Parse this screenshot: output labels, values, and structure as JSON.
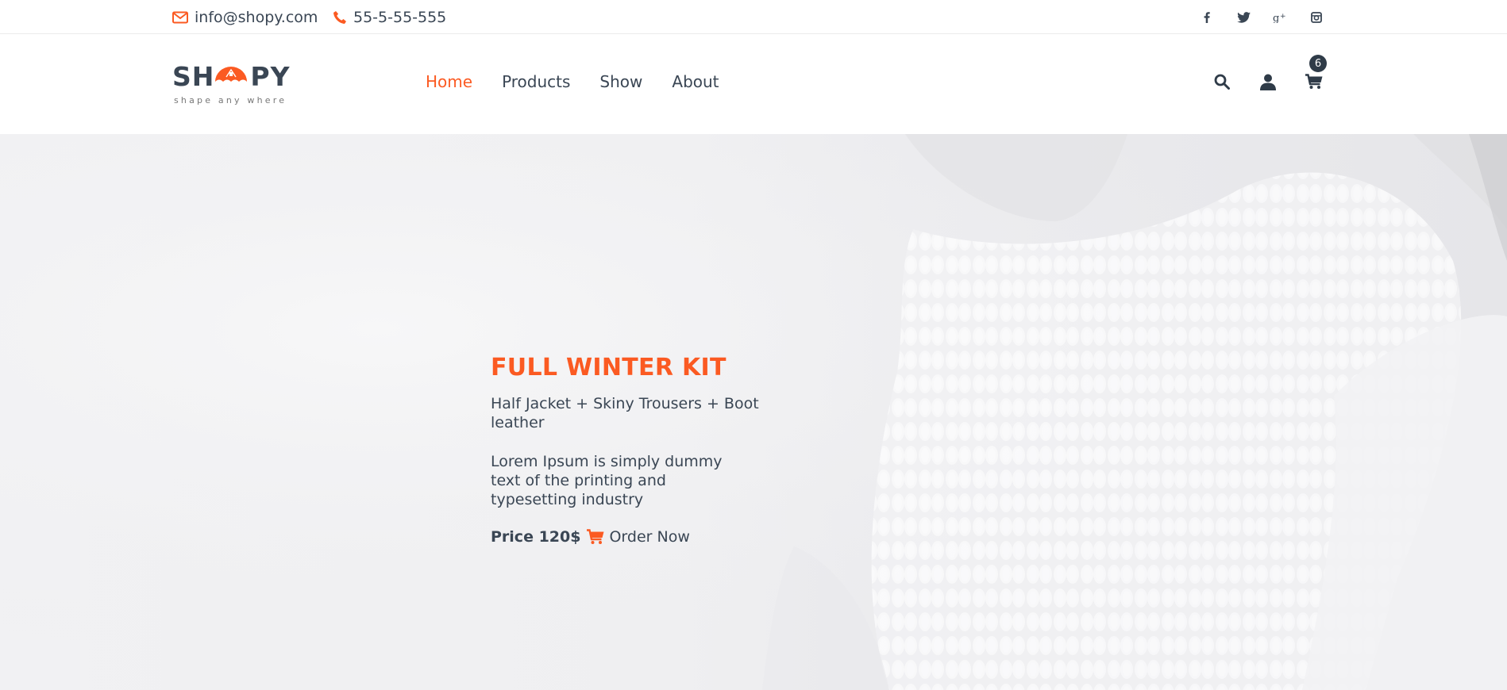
{
  "topbar": {
    "email": "info@shopy.com",
    "phone": "55-5-55-555",
    "socials": [
      "facebook-icon",
      "twitter-icon",
      "google-plus-icon",
      "instagram-icon"
    ]
  },
  "logo": {
    "left_text": "SH",
    "right_text": "PY",
    "tagline": "shape any where"
  },
  "nav": {
    "items": [
      {
        "label": "Home",
        "active": true
      },
      {
        "label": "Products",
        "active": false
      },
      {
        "label": "Show",
        "active": false
      },
      {
        "label": "About",
        "active": false
      }
    ]
  },
  "actions": {
    "icons": [
      "search-icon",
      "user-icon",
      "cart-icon"
    ],
    "cart_count": "6"
  },
  "hero": {
    "title": "FULL WINTER KIT",
    "subtitle": "Half Jacket + Skiny Trousers + Boot leather",
    "description": "Lorem Ipsum is simply dummy text of the printing and typesetting industry",
    "price": "Price 120$",
    "order_label": "Order Now"
  },
  "colors": {
    "accent": "#fb5a22",
    "text": "#3a4654"
  }
}
